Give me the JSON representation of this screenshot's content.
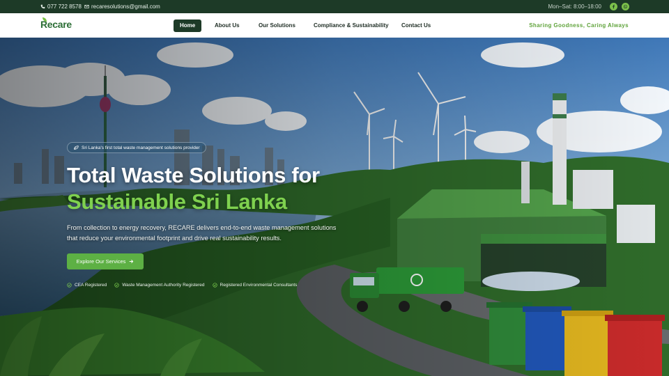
{
  "topbar": {
    "phone": "077 722 8578",
    "email": "recaresolutions@gmail.com",
    "hours": "Mon–Sat: 8:00–18:00",
    "social": [
      {
        "icon": "facebook-icon"
      },
      {
        "icon": "whatsapp-icon"
      }
    ]
  },
  "nav": {
    "logo": "Recare",
    "links": [
      {
        "label": "Home",
        "active": true
      },
      {
        "label": "About Us",
        "active": false
      },
      {
        "label": "Our Solutions",
        "active": false
      },
      {
        "label": "Compliance & Sustainability",
        "active": false
      },
      {
        "label": "Contact Us",
        "active": false
      }
    ],
    "tagline": "Sharing Goodness, Caring Always"
  },
  "hero": {
    "badge": "Sri Lanka's first total waste management solutions provider",
    "headline_line1": "Total Waste Solutions for",
    "headline_line2": "Sustainable Sri Lanka",
    "description": "From collection to energy recovery, RECARE delivers end-to-end waste management solutions that reduce your environmental footprint and drive real sustainability results.",
    "cta_label": "Explore Our Services",
    "certifications": [
      "CEA Registered",
      "Waste Management Authority Registered",
      "Registered Environmental Consultants"
    ]
  },
  "colors": {
    "brand_dark": "#1d3a27",
    "brand_green": "#5db044",
    "headline_accent": "#7fd14f"
  }
}
